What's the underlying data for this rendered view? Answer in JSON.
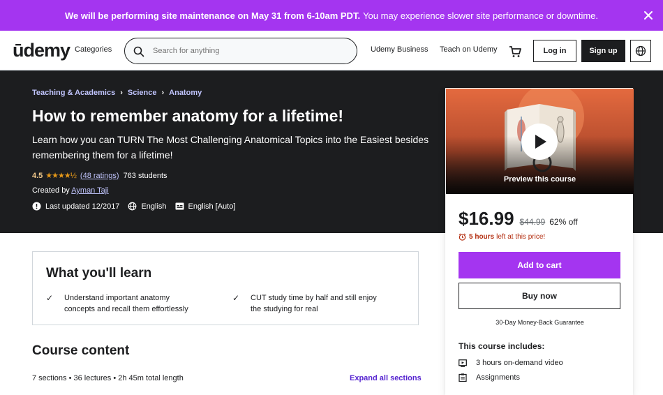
{
  "banner": {
    "bold": "We will be performing site maintenance on May 31 from 6-10am PDT.",
    "rest": "You may experience slower site performance or downtime."
  },
  "header": {
    "logo": "ūdemy",
    "categories": "Categories",
    "search_placeholder": "Search for anything",
    "business": "Udemy Business",
    "teach": "Teach on Udemy",
    "login": "Log in",
    "signup": "Sign up"
  },
  "course": {
    "breadcrumbs": [
      "Teaching & Academics",
      "Science",
      "Anatomy"
    ],
    "title": "How to remember anatomy for a lifetime!",
    "subtitle": "Learn how you can TURN The Most Challenging Anatomical Topics into the Easiest besides remembering them for a lifetime!",
    "rating": "4.5",
    "stars": "★★★★½",
    "ratings_count": "(48 ratings)",
    "students": "763 students",
    "created_by_label": "Created by",
    "author": "Ayman Taji",
    "last_updated": "Last updated 12/2017",
    "language": "English",
    "captions": "English [Auto]"
  },
  "learn": {
    "heading": "What you'll learn",
    "items": [
      "Understand important anatomy concepts and recall them effortlessly",
      "CUT study time by half and still enjoy the studying for real"
    ]
  },
  "content": {
    "heading": "Course content",
    "meta": "7 sections • 36 lectures • 2h 45m total length",
    "expand": "Expand all sections"
  },
  "card": {
    "preview_label": "Preview this course",
    "price": "$16.99",
    "original_price": "$44.99",
    "discount": "62% off",
    "timer_hours": "5 hours",
    "timer_rest": "left at this price!",
    "add_to_cart": "Add to cart",
    "buy_now": "Buy now",
    "guarantee": "30-Day Money-Back Guarantee",
    "includes_heading": "This course includes:",
    "includes": [
      "3 hours on-demand video",
      "Assignments"
    ]
  },
  "colors": {
    "brand_purple": "#a435f0",
    "dark": "#1c1d1f",
    "link_lilac": "#c0c4fc",
    "star": "#e59819",
    "urgent": "#b32d0f"
  }
}
